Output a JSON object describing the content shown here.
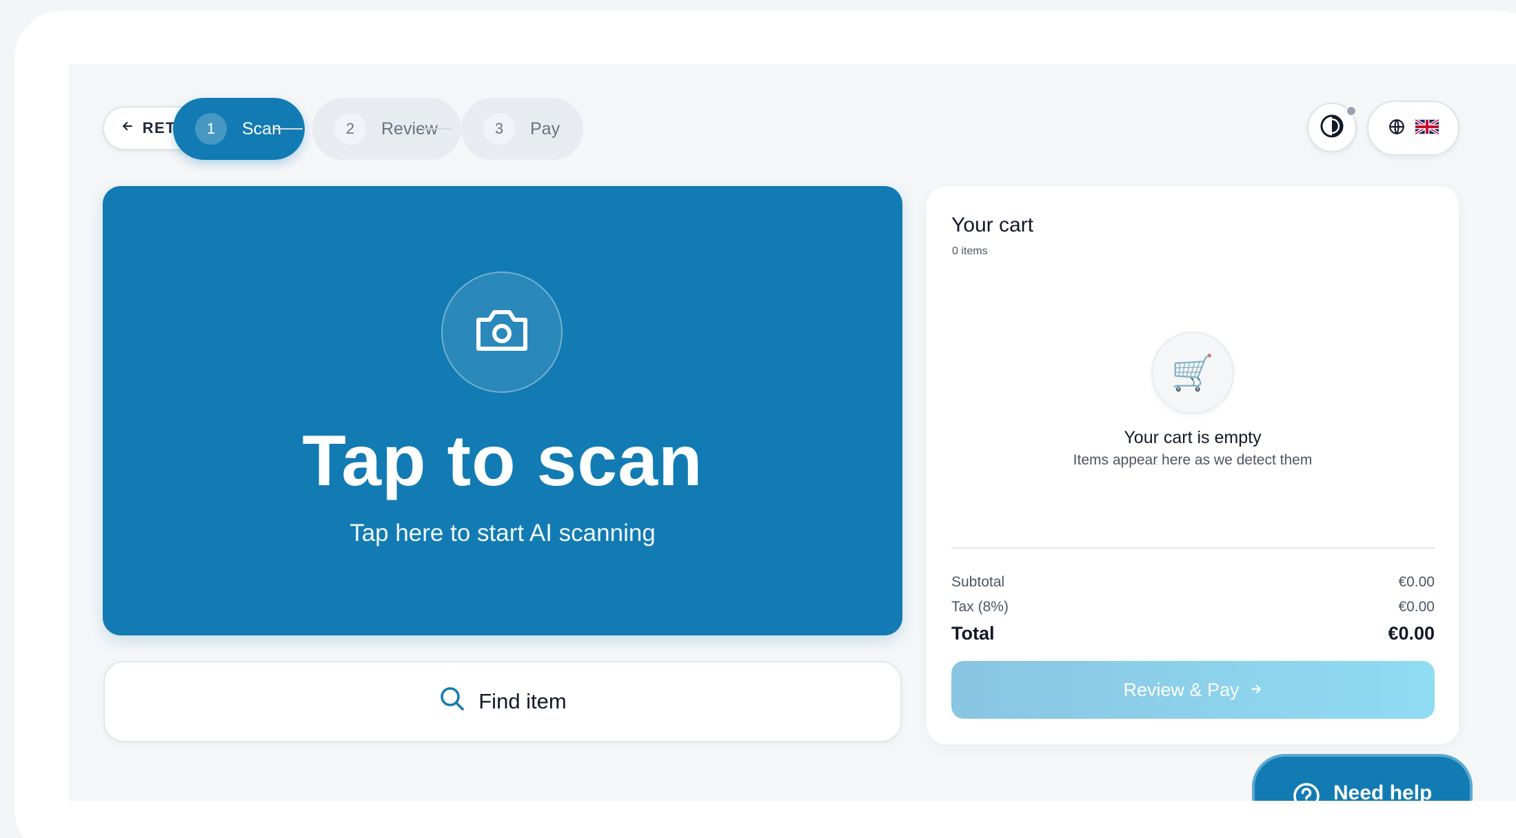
{
  "nav": {
    "return_label": "RETURN",
    "steps": [
      {
        "num": "1",
        "label": "Scan",
        "active": true
      },
      {
        "num": "2",
        "label": "Review",
        "active": false
      },
      {
        "num": "3",
        "label": "Pay",
        "active": false
      }
    ],
    "language_flag": "🇬🇧"
  },
  "scan": {
    "title": "Tap to scan",
    "subtitle": "Tap here to start AI scanning"
  },
  "find_item": {
    "label": "Find item"
  },
  "cart": {
    "title": "Your cart",
    "count": "0 items",
    "empty_title": "Your cart is empty",
    "empty_subtitle": "Items appear here as we detect them",
    "cart_emoji": "🛒",
    "subtotal_label": "Subtotal",
    "subtotal_value": "€0.00",
    "tax_label": "Tax (8%)",
    "tax_value": "€0.00",
    "total_label": "Total",
    "total_value": "€0.00",
    "pay_label": "Review & Pay"
  },
  "help": {
    "label": "Need help"
  },
  "colors": {
    "accent": "#127bb3",
    "pay_button_start": "#8ac5e2",
    "pay_button_end": "#8fdcf3"
  }
}
